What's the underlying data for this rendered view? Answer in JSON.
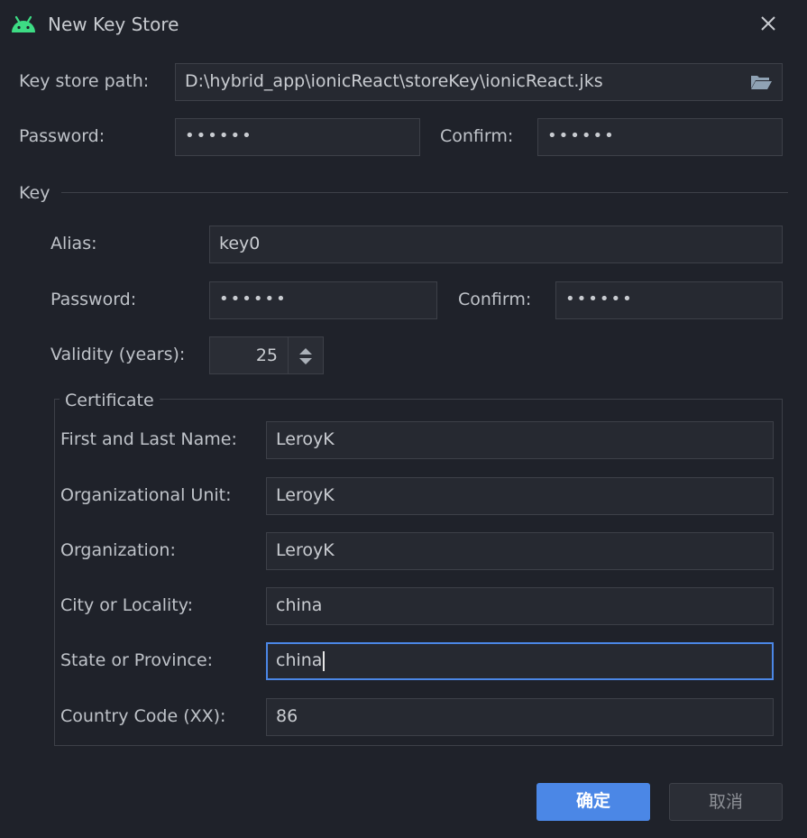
{
  "window": {
    "title": "New Key Store"
  },
  "keystore": {
    "path_label": "Key store path:",
    "path_value": "D:\\hybrid_app\\ionicReact\\storeKey\\ionicReact.jks",
    "password_label": "Password:",
    "password_value": "••••••",
    "confirm_label": "Confirm:",
    "confirm_value": "••••••"
  },
  "key": {
    "section_label": "Key",
    "alias_label": "Alias:",
    "alias_value": "key0",
    "password_label": "Password:",
    "password_value": "••••••",
    "confirm_label": "Confirm:",
    "confirm_value": "••••••",
    "validity_label": "Validity (years):",
    "validity_value": "25"
  },
  "certificate": {
    "group_label": "Certificate",
    "fields": [
      {
        "label": "First and Last Name:",
        "value": "LeroyK"
      },
      {
        "label": "Organizational Unit:",
        "value": "LeroyK"
      },
      {
        "label": "Organization:",
        "value": "LeroyK"
      },
      {
        "label": "City or Locality:",
        "value": "china"
      },
      {
        "label": "State or Province:",
        "value": "china"
      },
      {
        "label": "Country Code (XX):",
        "value": "86"
      }
    ]
  },
  "buttons": {
    "ok": "确定",
    "cancel": "取消"
  },
  "colors": {
    "accent": "#4b87e6",
    "android_green": "#3ddc84",
    "background": "#1f222a"
  },
  "icons": {
    "app": "android-icon",
    "close": "close-icon",
    "browse": "folder-open-icon",
    "spinner": "up-down-arrows-icon"
  }
}
